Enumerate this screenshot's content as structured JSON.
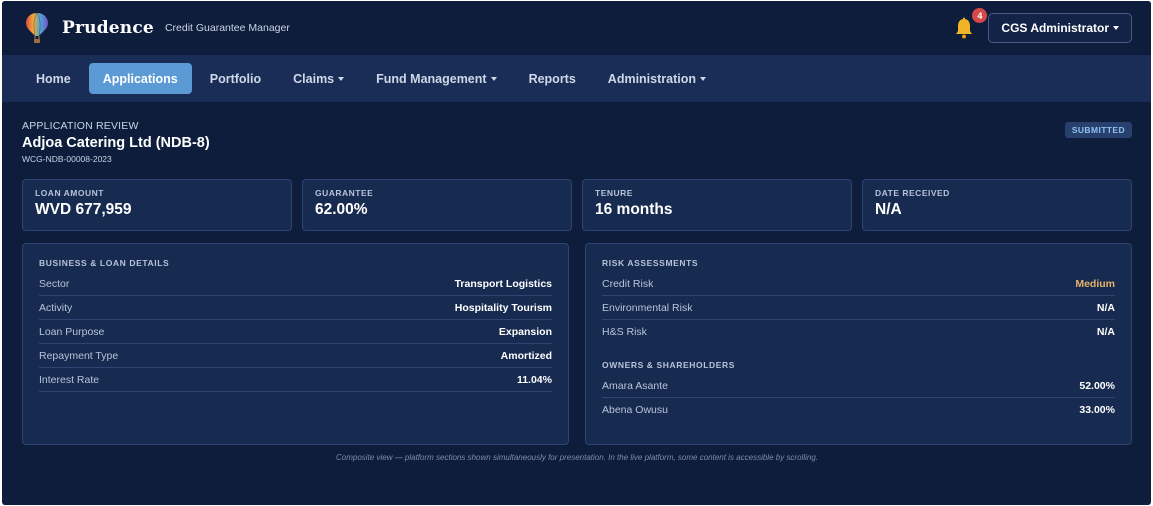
{
  "brand": {
    "name": "Prudence",
    "subtitle": "Credit Guarantee Manager"
  },
  "header": {
    "notification_count": "4",
    "user_label": "CGS Administrator",
    "icons": [
      "hot-air-balloon-icon",
      "bell-icon"
    ]
  },
  "nav": {
    "items": [
      {
        "label": "Home",
        "active": false,
        "dropdown": false
      },
      {
        "label": "Applications",
        "active": true,
        "dropdown": false
      },
      {
        "label": "Portfolio",
        "active": false,
        "dropdown": false
      },
      {
        "label": "Claims",
        "active": false,
        "dropdown": true
      },
      {
        "label": "Fund Management",
        "active": false,
        "dropdown": true
      },
      {
        "label": "Reports",
        "active": false,
        "dropdown": false
      },
      {
        "label": "Administration",
        "active": false,
        "dropdown": true
      }
    ]
  },
  "application": {
    "overline": "APPLICATION REVIEW",
    "title": "Adjoa Catering Ltd (NDB-8)",
    "reference": "WCG-NDB-00008-2023",
    "status": "SUBMITTED"
  },
  "stats": [
    {
      "label": "LOAN AMOUNT",
      "value": "WVD 677,959"
    },
    {
      "label": "GUARANTEE",
      "value": "62.00%"
    },
    {
      "label": "TENURE",
      "value": "16 months"
    },
    {
      "label": "DATE RECEIVED",
      "value": "N/A"
    }
  ],
  "business": {
    "title": "BUSINESS & LOAN DETAILS",
    "rows": [
      {
        "label": "Sector",
        "value": "Transport Logistics"
      },
      {
        "label": "Activity",
        "value": "Hospitality Tourism"
      },
      {
        "label": "Loan Purpose",
        "value": "Expansion"
      },
      {
        "label": "Repayment Type",
        "value": "Amortized"
      },
      {
        "label": "Interest Rate",
        "value": "11.04%"
      }
    ]
  },
  "risk": {
    "title": "RISK ASSESSMENTS",
    "rows": [
      {
        "label": "Credit Risk",
        "value": "Medium"
      },
      {
        "label": "Environmental Risk",
        "value": "N/A"
      },
      {
        "label": "H&S Risk",
        "value": "N/A"
      }
    ]
  },
  "owners": {
    "title": "OWNERS & SHAREHOLDERS",
    "rows": [
      {
        "label": "Amara Asante",
        "value": "52.00%"
      },
      {
        "label": "Abena Owusu",
        "value": "33.00%"
      }
    ]
  },
  "footnote": "Composite view — platform sections shown simultaneously for presentation. In the live platform, some content is accessible by scrolling.",
  "colors": {
    "background": "#0f1d3d",
    "nav": "#1a2d57",
    "active_tab": "#5b9ad4",
    "badge": "#d64848",
    "risk_medium": "#e8b36a"
  }
}
